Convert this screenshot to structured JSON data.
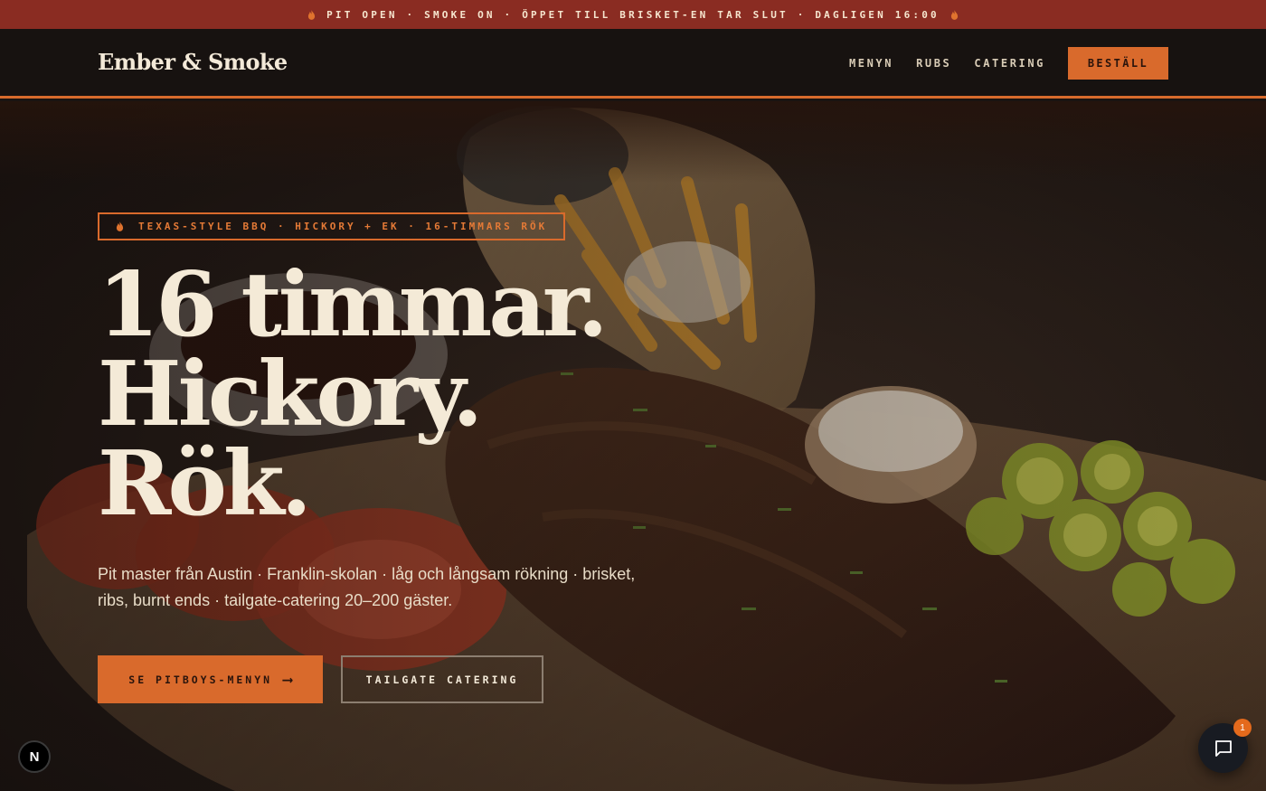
{
  "announcement": {
    "text": "PIT OPEN · SMOKE ON · ÖPPET TILL BRISKET-EN TAR SLUT · DAGLIGEN 16:00",
    "icon": "flame-icon"
  },
  "header": {
    "logo": "Ember & Smoke",
    "nav": {
      "menu": "MENYN",
      "rubs": "RUBS",
      "catering": "CATERING",
      "order": "BESTÄLL"
    }
  },
  "hero": {
    "badge": "TEXAS-STYLE BBQ · HICKORY + EK · 16-TIMMARS RÖK",
    "headline": [
      "16 timmar.",
      "Hickory.",
      "Rök."
    ],
    "lead": "Pit master från Austin · Franklin-skolan · låg och långsam rökning · brisket, ribs, burnt ends · tailgate-catering 20–200 gäster.",
    "primary_cta": "SE PITBOYS-MENYN",
    "primary_cta_arrow": "⟶",
    "secondary_cta": "TAILGATE CATERING"
  },
  "widgets": {
    "dev_badge": "N",
    "chat_unread": "1"
  },
  "colors": {
    "accent": "#d96a2c",
    "announcement_bg": "#8a2c22",
    "header_bg": "#171210",
    "text_cream": "#f4ead7"
  }
}
